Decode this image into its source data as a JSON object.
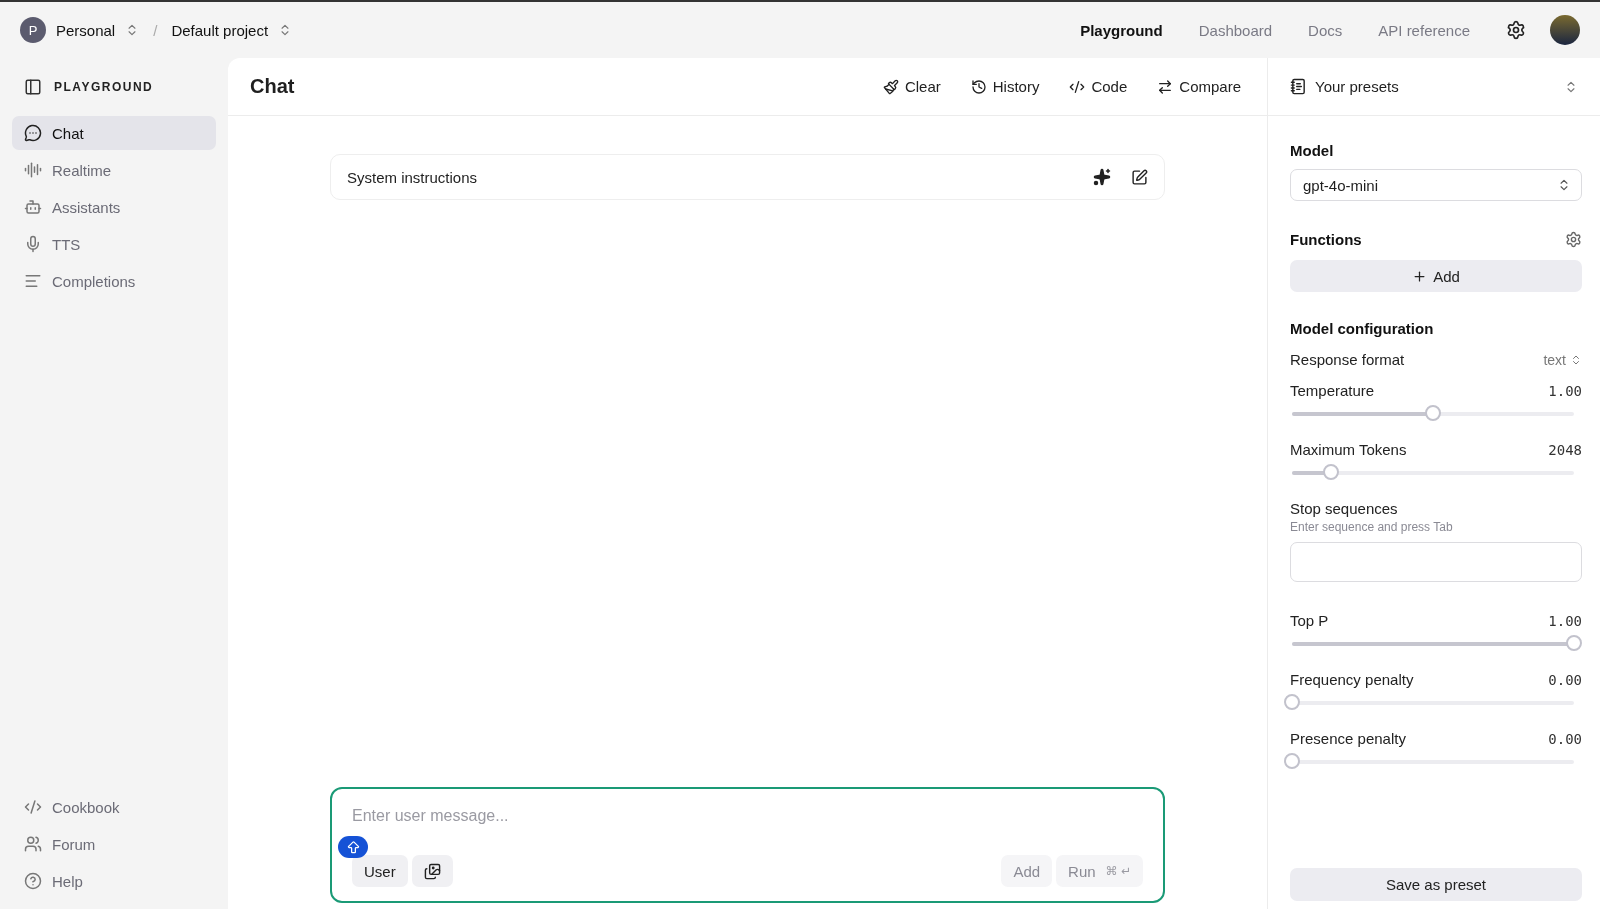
{
  "topbar": {
    "org": {
      "initial": "P",
      "name": "Personal"
    },
    "separator": "/",
    "project": "Default project",
    "links": [
      {
        "label": "Playground",
        "selected": true
      },
      {
        "label": "Dashboard",
        "selected": false
      },
      {
        "label": "Docs",
        "selected": false
      },
      {
        "label": "API reference",
        "selected": false
      }
    ]
  },
  "sidebar": {
    "title": "PLAYGROUND",
    "items": [
      {
        "label": "Chat",
        "selected": true
      },
      {
        "label": "Realtime",
        "selected": false
      },
      {
        "label": "Assistants",
        "selected": false
      },
      {
        "label": "TTS",
        "selected": false
      },
      {
        "label": "Completions",
        "selected": false
      }
    ],
    "footer_items": [
      {
        "label": "Cookbook"
      },
      {
        "label": "Forum"
      },
      {
        "label": "Help"
      }
    ]
  },
  "main": {
    "title": "Chat",
    "actions": [
      {
        "label": "Clear"
      },
      {
        "label": "History"
      },
      {
        "label": "Code"
      },
      {
        "label": "Compare"
      }
    ],
    "system_instructions": {
      "label": "System instructions"
    },
    "composer": {
      "placeholder": "Enter user message...",
      "role": "User",
      "buttons": [
        {
          "label": "Add",
          "disabled": true
        },
        {
          "label": "Run",
          "shortcut": "⌘ ↵",
          "disabled": true
        }
      ]
    }
  },
  "presets": {
    "title": "Your presets",
    "model": {
      "label": "Model",
      "value": "gpt-4o-mini"
    },
    "functions": {
      "label": "Functions",
      "add": "Add"
    },
    "config": {
      "title": "Model configuration",
      "response_format": {
        "label": "Response format",
        "value": "text"
      },
      "sliders_top": [
        {
          "label": "Temperature",
          "reading": "1.00",
          "level": 0.5
        },
        {
          "label": "Maximum Tokens",
          "reading": "2048",
          "level": 0.14
        }
      ],
      "stop_sequences": {
        "label": "Stop sequences",
        "hint": "Enter sequence and press Tab"
      },
      "sliders_bottom": [
        {
          "label": "Top P",
          "reading": "1.00",
          "level": 1
        },
        {
          "label": "Frequency penalty",
          "reading": "0.00",
          "level": 0
        },
        {
          "label": "Presence penalty",
          "reading": "0.00",
          "level": 0
        }
      ]
    },
    "save": "Save as preset"
  }
}
